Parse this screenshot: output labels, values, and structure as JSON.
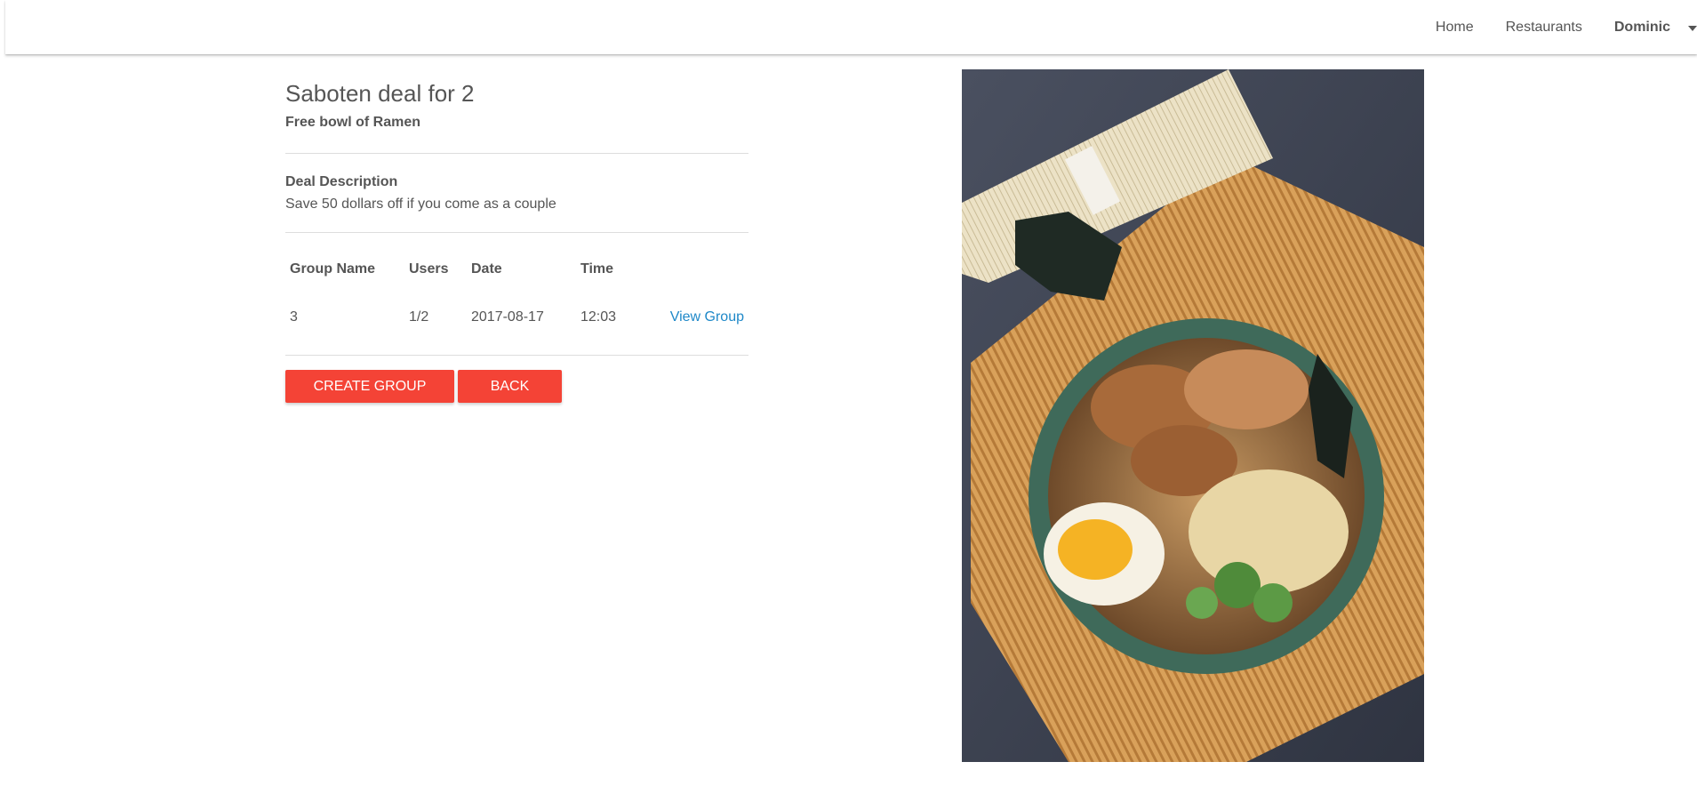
{
  "nav": {
    "home": "Home",
    "restaurants": "Restaurants",
    "user": "Dominic"
  },
  "deal": {
    "title": "Saboten deal for 2",
    "subtitle": "Free bowl of Ramen",
    "description_label": "Deal Description",
    "description": "Save 50 dollars off if you come as a couple"
  },
  "table": {
    "headers": [
      "Group Name",
      "Users",
      "Date",
      "Time",
      ""
    ],
    "rows": [
      {
        "group_name": "3",
        "users": "1/2",
        "date": "2017-08-17",
        "time": "12:03",
        "action": "View Group"
      }
    ]
  },
  "buttons": {
    "create": "CREATE GROUP",
    "back": "BACK"
  },
  "image": {
    "icon": "ramen-photo"
  },
  "colors": {
    "primary": "#f44336",
    "link": "#1e88c8",
    "text": "#555555"
  }
}
